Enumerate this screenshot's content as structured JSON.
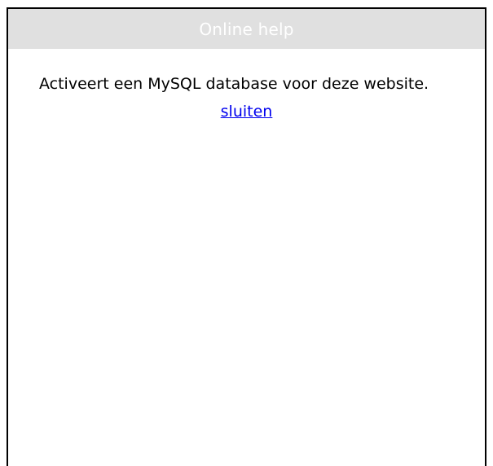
{
  "window": {
    "title": "Online help"
  },
  "help": {
    "text": "Activeert een MySQL database voor deze website.",
    "close_label": "sluiten"
  },
  "colors": {
    "title_bar_bg": "#e0e0e0",
    "title_text": "#ffffff",
    "link": "#0000ee",
    "border": "#000000"
  }
}
